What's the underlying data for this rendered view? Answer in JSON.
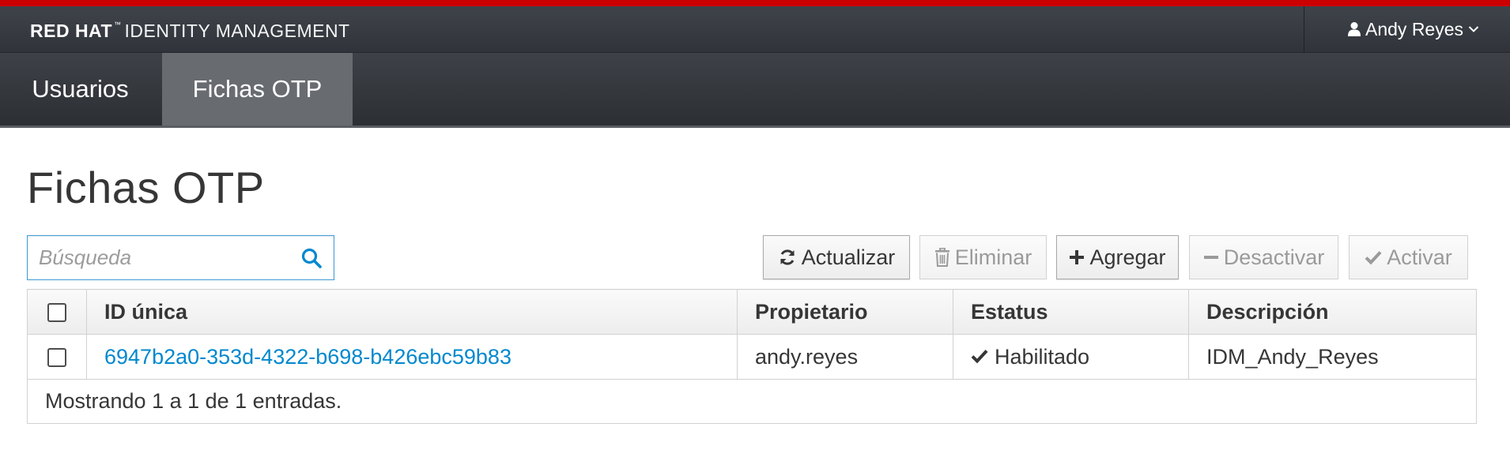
{
  "brand": {
    "name_bold": "RED HAT",
    "name_rest": "IDENTITY MANAGEMENT"
  },
  "user_menu": {
    "name": "Andy Reyes"
  },
  "nav": {
    "items": [
      {
        "label": "Usuarios"
      },
      {
        "label": "Fichas OTP",
        "active": true
      }
    ]
  },
  "page": {
    "title": "Fichas OTP"
  },
  "search": {
    "placeholder": "Búsqueda",
    "value": ""
  },
  "toolbar": {
    "refresh_label": "Actualizar",
    "delete_label": "Eliminar",
    "add_label": "Agregar",
    "deactivate_label": "Desactivar",
    "activate_label": "Activar"
  },
  "table": {
    "headers": [
      "ID única",
      "Propietario",
      "Estatus",
      "Descripción"
    ],
    "rows": [
      {
        "id": "6947b2a0-353d-4322-b698-b426ebc59b83",
        "owner": "andy.reyes",
        "status": "Habilitado",
        "description": "IDM_Andy_Reyes"
      }
    ],
    "footer": "Mostrando 1 a 1 de 1 entradas."
  },
  "colors": {
    "accent_stripe": "#cc0000",
    "link": "#0088ce",
    "focus_border": "#3b9ad6",
    "masthead": "#393d43"
  },
  "icons": {
    "user": "user-icon",
    "dropdown": "chevron-down-icon",
    "search": "search-icon",
    "refresh": "refresh-icon",
    "delete": "trash-icon",
    "add": "plus-icon",
    "deactivate": "minus-icon",
    "activate": "check-icon",
    "status": "check-icon"
  }
}
